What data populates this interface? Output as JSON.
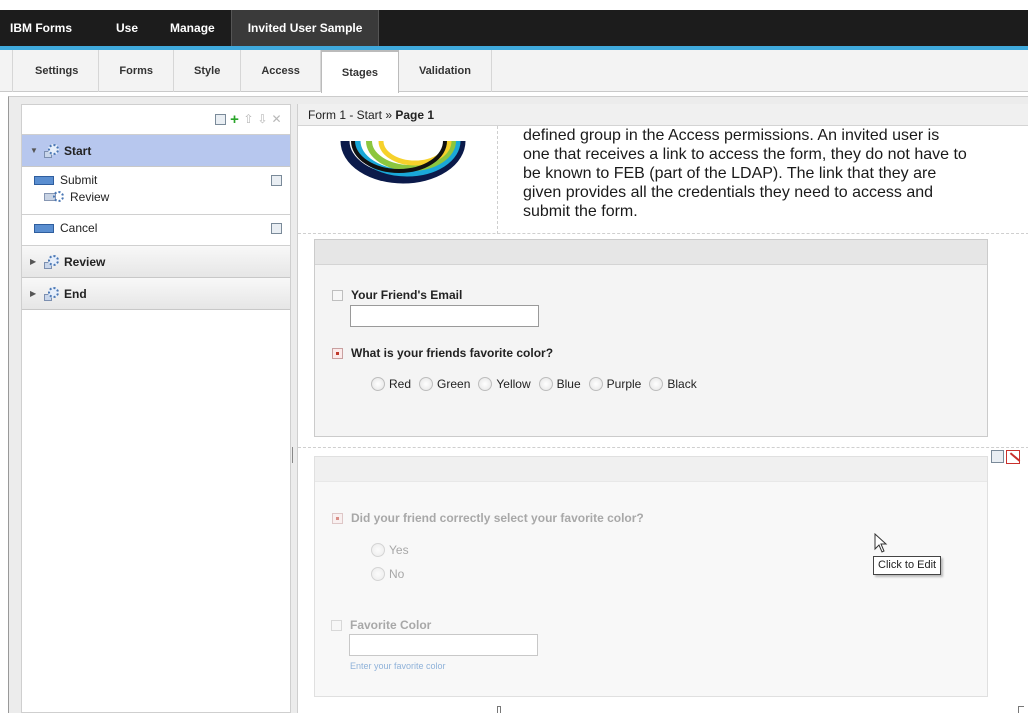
{
  "topbar": {
    "brand": "IBM Forms",
    "items": [
      "Use",
      "Manage"
    ],
    "app_title": "Invited User Sample"
  },
  "tabs": [
    "Settings",
    "Forms",
    "Style",
    "Access",
    "Stages",
    "Validation"
  ],
  "active_tab": "Stages",
  "stages": {
    "start": {
      "name": "Start",
      "actions": [
        {
          "label": "Submit",
          "target": "Review"
        },
        {
          "label": "Cancel"
        }
      ]
    },
    "review": {
      "name": "Review"
    },
    "end": {
      "name": "End"
    }
  },
  "breadcrumb": {
    "path": "Form 1 - Start » ",
    "page": "Page 1"
  },
  "intro_text": {
    "line1": "defined group in the Access permissions.  An invited user is",
    "line2": "one that receives a link to access the form, they do not have to",
    "line3": "be known to FEB (part of the LDAP).  The link that they are",
    "line4": "given provides all the credentials they need to access and",
    "line5": "submit the form."
  },
  "section1": {
    "email_label": "Your Friend's Email",
    "color_question": "What is your friends favorite color?",
    "color_options": [
      "Red",
      "Green",
      "Yellow",
      "Blue",
      "Purple",
      "Black"
    ]
  },
  "section2": {
    "question": "Did your friend correctly select your favorite color?",
    "options": [
      "Yes",
      "No"
    ],
    "favorite_label": "Favorite Color",
    "favorite_hint": "Enter your favorite color"
  },
  "tooltip": "Click to Edit",
  "colors": {
    "topbar": "#1c1c1c",
    "accent_line": "#3fa9dc",
    "selected_stage": "#b7c7ee"
  }
}
